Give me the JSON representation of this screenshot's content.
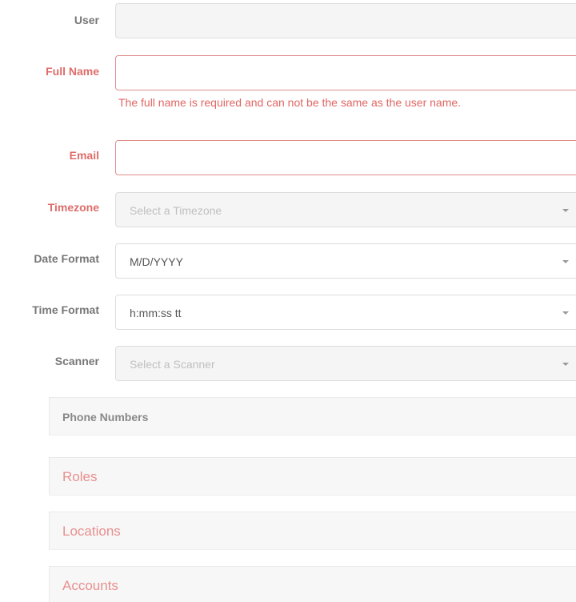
{
  "form": {
    "user": {
      "label": "User",
      "value": ""
    },
    "full_name": {
      "label": "Full Name",
      "value": "",
      "help": "The full name is required and can not be the same as the user name."
    },
    "email": {
      "label": "Email",
      "value": ""
    },
    "timezone": {
      "label": "Timezone",
      "placeholder": "Select a Timezone"
    },
    "date_format": {
      "label": "Date Format",
      "value": "M/D/YYYY"
    },
    "time_format": {
      "label": "Time Format",
      "value": "h:mm:ss tt"
    },
    "scanner": {
      "label": "Scanner",
      "placeholder": "Select a Scanner"
    }
  },
  "panels": {
    "phone_numbers": "Phone Numbers",
    "roles": "Roles",
    "locations": "Locations",
    "accounts": "Accounts"
  },
  "colors": {
    "error": "#d9534f",
    "label": "#777777"
  }
}
